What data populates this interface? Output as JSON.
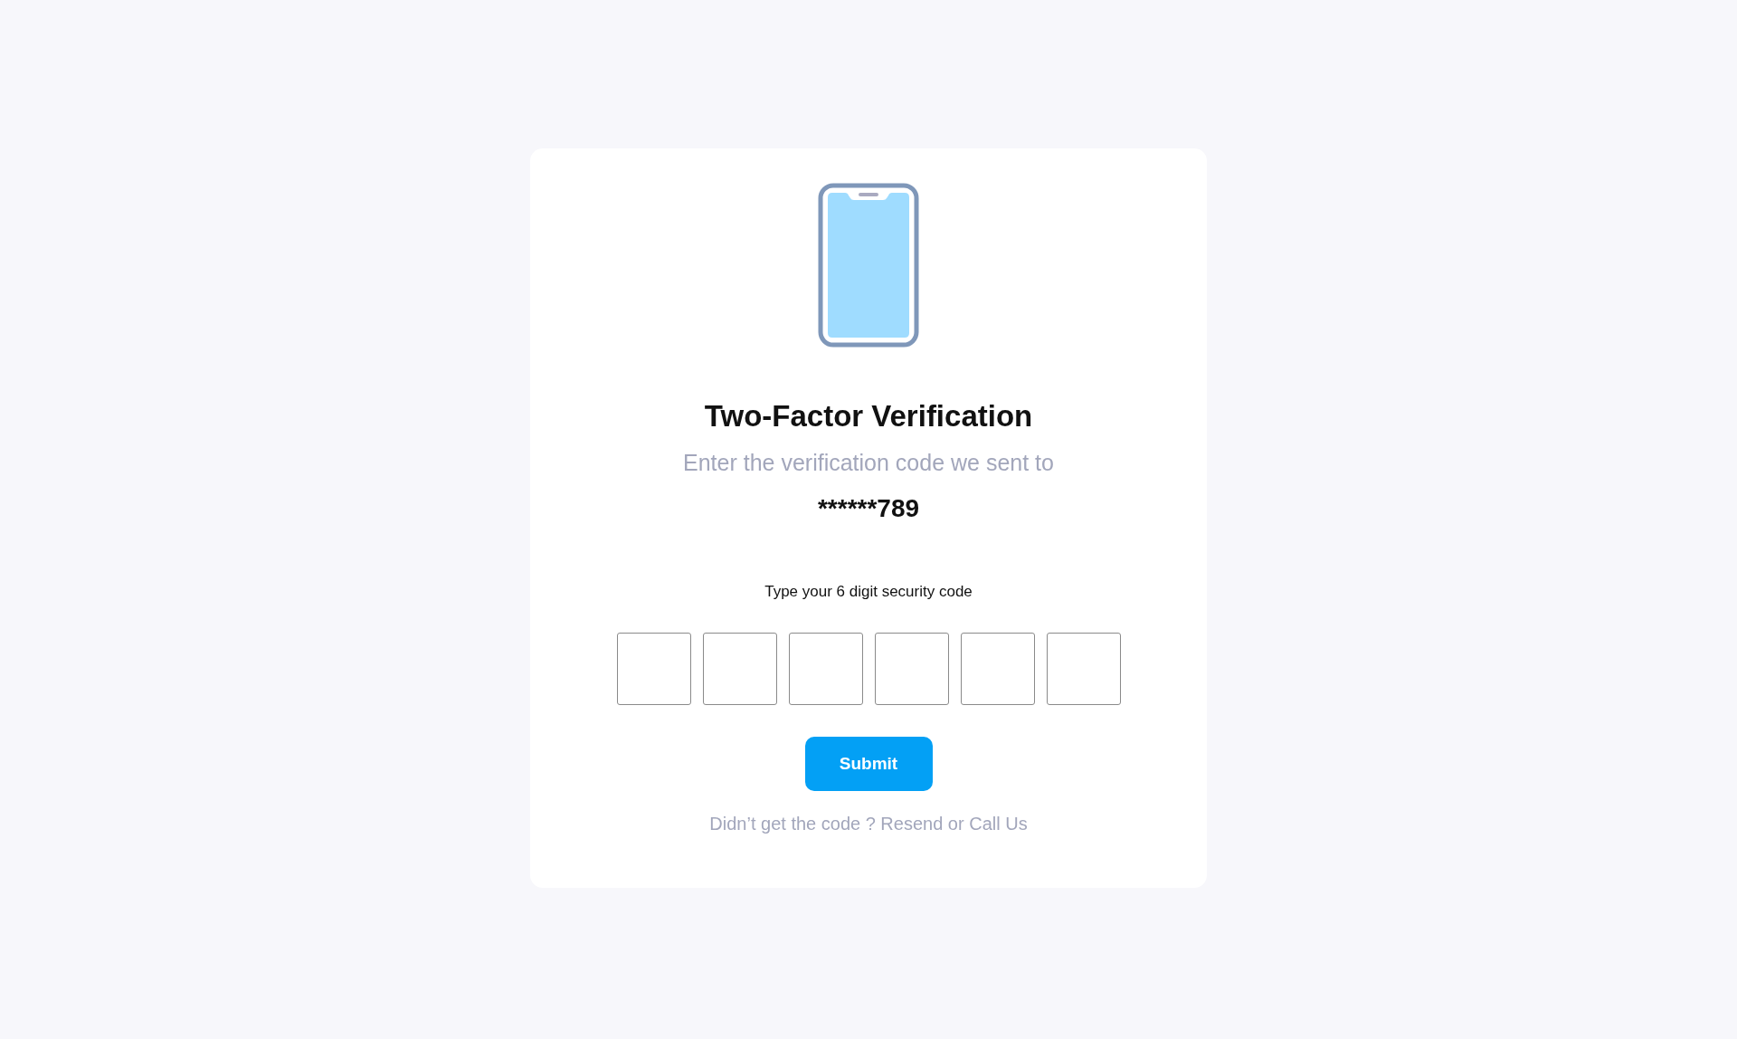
{
  "card": {
    "title": "Two-Factor Verification",
    "subtitle": "Enter the verification code we sent to",
    "phone": "******789",
    "code_label": "Type your 6 digit security code",
    "code_fields": [
      {
        "filled": false
      },
      {
        "filled": false
      },
      {
        "filled": false
      },
      {
        "filled": false
      },
      {
        "filled": false
      },
      {
        "filled": false
      }
    ],
    "submit": "Submit",
    "footer": "Didn’t get the code ? Resend or Call Us"
  }
}
